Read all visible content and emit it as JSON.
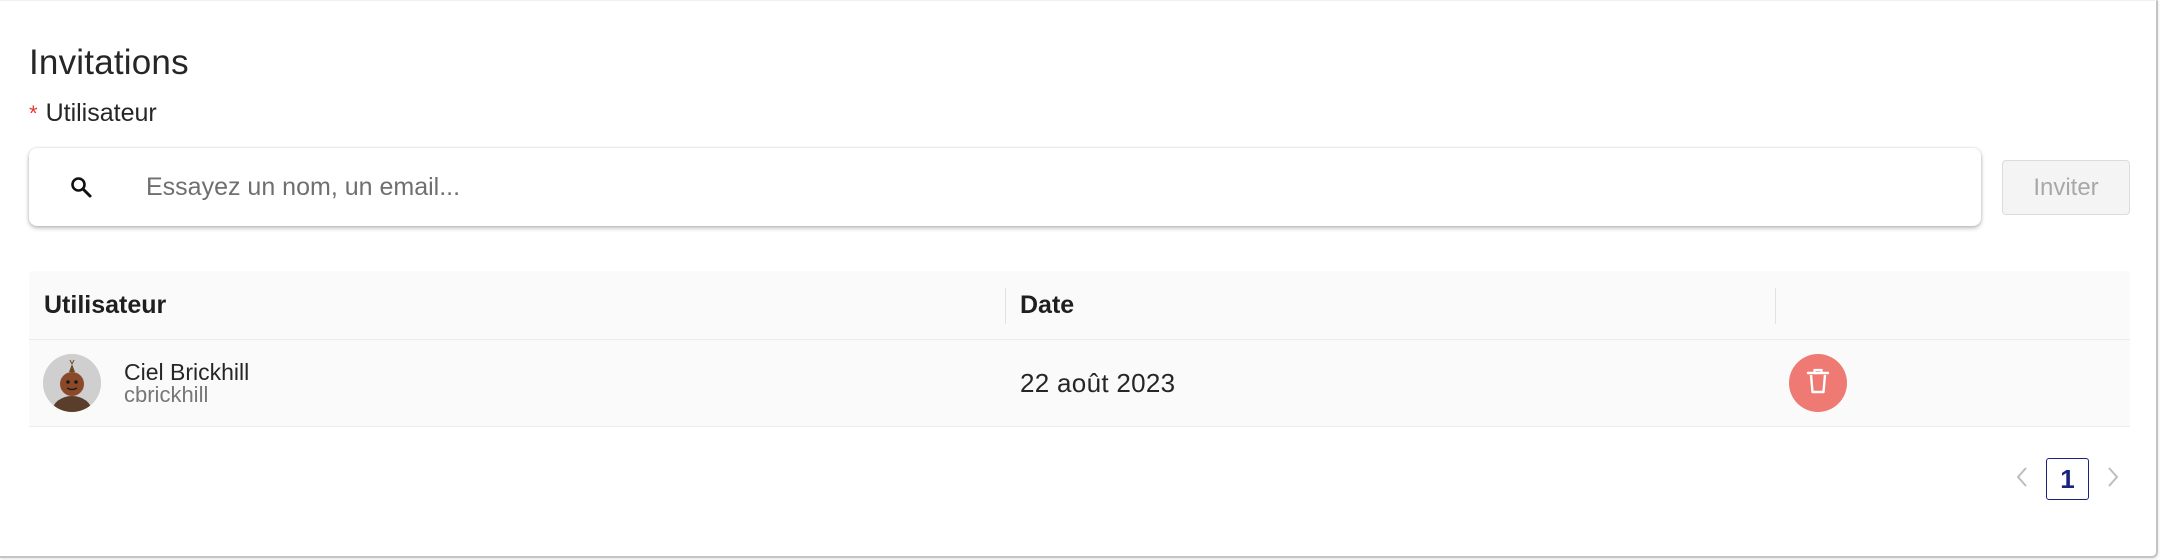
{
  "section": {
    "title": "Invitations",
    "required_mark": "*",
    "field_label": "Utilisateur"
  },
  "search": {
    "value": "",
    "placeholder": "Essayez un nom, un email...",
    "icon": "search-icon"
  },
  "invite_button": {
    "label": "Inviter",
    "disabled": true
  },
  "table": {
    "columns": [
      "Utilisateur",
      "Date",
      ""
    ],
    "rows": [
      {
        "name": "Ciel Brickhill",
        "login": "cbrickhill",
        "date": "22 août 2023",
        "action_icon": "trash-icon"
      }
    ]
  },
  "pagination": {
    "current_page": "1",
    "prev_icon": "chevron-left-icon",
    "next_icon": "chevron-right-icon"
  },
  "colors": {
    "delete_button": "#ee7a73",
    "pagination_accent": "#1a237e",
    "required_mark": "#e53935"
  }
}
